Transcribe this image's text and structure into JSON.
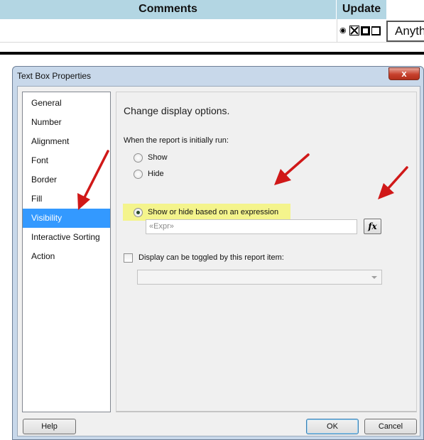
{
  "report": {
    "columns": [
      "Comments",
      "Update"
    ],
    "cell_text": "Anyth",
    "icons": [
      "eye-icon",
      "x-box-icon",
      "square-icon",
      "square-outline-icon"
    ]
  },
  "dialog": {
    "title": "Text Box Properties",
    "close_label": "x",
    "nav_items": [
      {
        "label": "General",
        "selected": false
      },
      {
        "label": "Number",
        "selected": false
      },
      {
        "label": "Alignment",
        "selected": false
      },
      {
        "label": "Font",
        "selected": false
      },
      {
        "label": "Border",
        "selected": false
      },
      {
        "label": "Fill",
        "selected": false
      },
      {
        "label": "Visibility",
        "selected": true
      },
      {
        "label": "Interactive Sorting",
        "selected": false
      },
      {
        "label": "Action",
        "selected": false
      }
    ],
    "heading": "Change display options.",
    "initial_label": "When the report is initially run:",
    "radios": [
      {
        "label": "Show",
        "checked": false
      },
      {
        "label": "Hide",
        "checked": false
      },
      {
        "label": "Show or hide based on an expression",
        "checked": true
      }
    ],
    "expression_value": "«Expr»",
    "fx_label": "fx",
    "toggle_label": "Display can be toggled by this report item:",
    "toggle_checked": false,
    "toggle_selected_value": "",
    "buttons": {
      "help": "Help",
      "ok": "OK",
      "cancel": "Cancel"
    }
  },
  "colors": {
    "header_bg": "#b3d6e3",
    "selection": "#3399ff",
    "highlight": "#f4f48c",
    "annotation_arrow": "#d01818"
  }
}
